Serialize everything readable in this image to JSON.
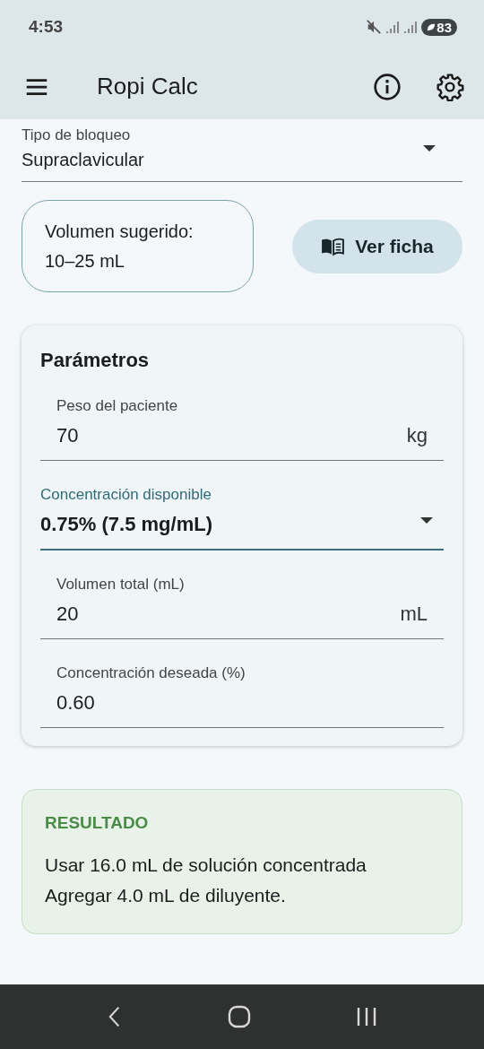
{
  "status_bar": {
    "time": "4:53",
    "battery": "83"
  },
  "app_bar": {
    "title": "Ropi Calc"
  },
  "block_type": {
    "label": "Tipo de bloqueo",
    "value": "Supraclavicular"
  },
  "suggestion": {
    "title": "Volumen sugerido:",
    "value": "10–25 mL"
  },
  "sheet_button": {
    "label": "Ver ficha"
  },
  "parameters": {
    "title": "Parámetros",
    "fields": [
      {
        "kind": "text",
        "label": "Peso del paciente",
        "value": "70",
        "suffix": "kg",
        "focused": false
      },
      {
        "kind": "select",
        "label": "Concentración disponible",
        "value": "0.75% (7.5 mg/mL)",
        "focused": true
      },
      {
        "kind": "text",
        "label": "Volumen total (mL)",
        "value": "20",
        "suffix": "mL",
        "focused": false
      },
      {
        "kind": "text",
        "label": "Concentración deseada (%)",
        "value": "0.60",
        "focused": false
      }
    ]
  },
  "result": {
    "title": "RESULTADO",
    "lines": [
      "Usar 16.0 mL de solución concentrada",
      "Agregar 4.0 mL de diluyente."
    ]
  }
}
